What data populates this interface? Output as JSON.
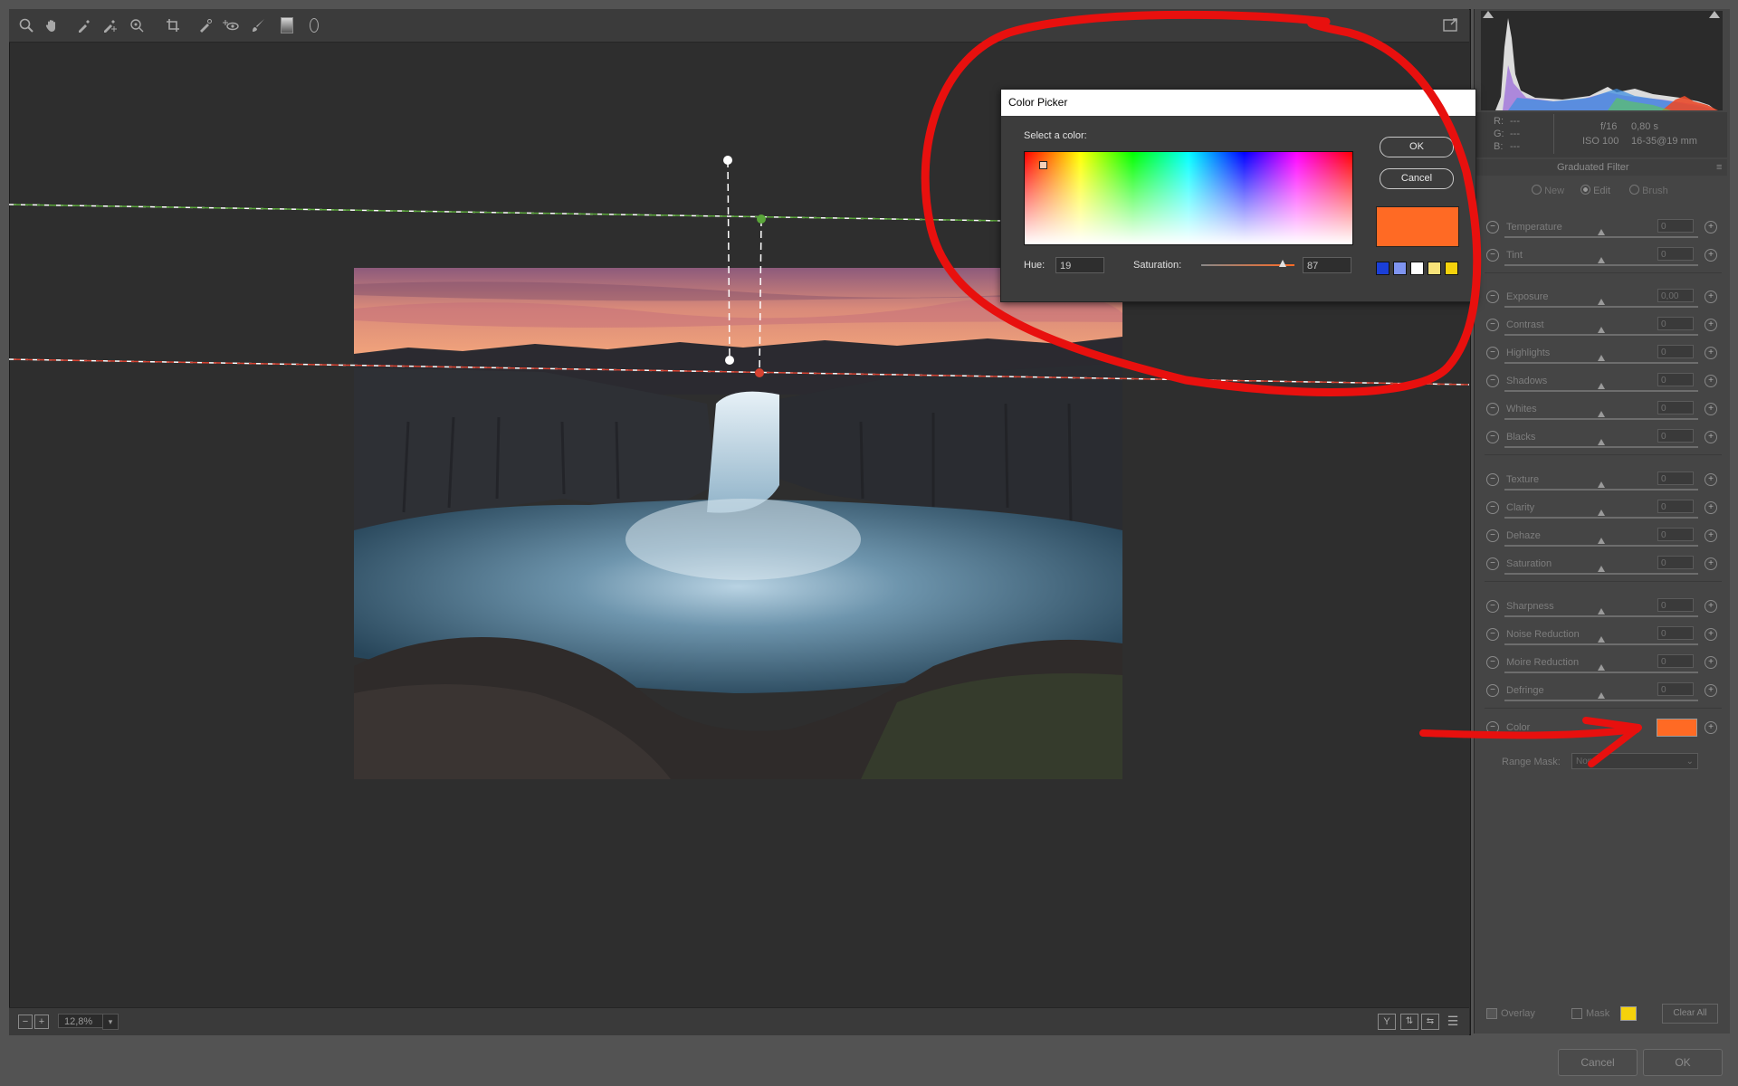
{
  "toolbar": {
    "tools": [
      "zoom-icon",
      "hand-icon",
      "white-balance-icon",
      "color-sampler-icon",
      "targeted-adjust-icon",
      "crop-icon",
      "spot-removal-icon",
      "red-eye-icon",
      "adjustment-brush-icon",
      "graduated-filter-icon",
      "radial-filter-icon"
    ]
  },
  "status": {
    "zoom_value": "12,8%",
    "zoom_out": "−",
    "zoom_in": "+"
  },
  "info": {
    "r_label": "R:",
    "g_label": "G:",
    "b_label": "B:",
    "r_val": "---",
    "g_val": "---",
    "b_val": "---",
    "aperture": "f/16",
    "shutter": "0,80 s",
    "iso": "ISO 100",
    "lens": "16-35@19 mm"
  },
  "panel": {
    "title": "Graduated Filter",
    "mode_new": "New",
    "mode_edit": "Edit",
    "mode_brush": "Brush",
    "groups": [
      [
        {
          "label": "Temperature",
          "value": "0"
        },
        {
          "label": "Tint",
          "value": "0"
        }
      ],
      [
        {
          "label": "Exposure",
          "value": "0,00"
        },
        {
          "label": "Contrast",
          "value": "0"
        },
        {
          "label": "Highlights",
          "value": "0"
        },
        {
          "label": "Shadows",
          "value": "0"
        },
        {
          "label": "Whites",
          "value": "0"
        },
        {
          "label": "Blacks",
          "value": "0"
        }
      ],
      [
        {
          "label": "Texture",
          "value": "0"
        },
        {
          "label": "Clarity",
          "value": "0"
        },
        {
          "label": "Dehaze",
          "value": "0"
        },
        {
          "label": "Saturation",
          "value": "0"
        }
      ],
      [
        {
          "label": "Sharpness",
          "value": "0"
        },
        {
          "label": "Noise Reduction",
          "value": "0"
        },
        {
          "label": "Moire Reduction",
          "value": "0"
        },
        {
          "label": "Defringe",
          "value": "0"
        }
      ]
    ],
    "color_label": "Color",
    "color_value": "#ff6a24",
    "range_mask_label": "Range Mask:",
    "range_mask_value": "None",
    "overlay_label": "Overlay",
    "mask_label": "Mask",
    "mask_color": "#f5d20c",
    "clear_all": "Clear All"
  },
  "footer": {
    "cancel": "Cancel",
    "ok": "OK"
  },
  "dialog": {
    "title": "Color Picker",
    "select_label": "Select a color:",
    "ok": "OK",
    "cancel": "Cancel",
    "hue_label": "Hue:",
    "hue_value": "19",
    "saturation_label": "Saturation:",
    "saturation_value": "87",
    "preview_color": "#ff6a24",
    "swatches": [
      "#1a3fd8",
      "#7f94f0",
      "#ffffff",
      "#f7e27a",
      "#f5d20c"
    ]
  },
  "annotation_color": "#e8100e"
}
